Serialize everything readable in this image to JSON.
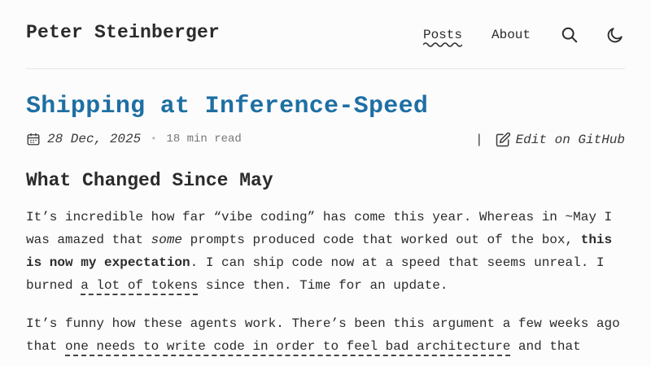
{
  "site": {
    "title": "Peter Steinberger"
  },
  "nav": {
    "posts_label": "Posts",
    "about_label": "About",
    "search_icon": "search-icon",
    "theme_icon": "moon-icon"
  },
  "post": {
    "title": "Shipping at Inference-Speed",
    "date": "28 Dec, 2025",
    "separator_dot": "•",
    "read_time": "18 min read",
    "meta_separator": "|",
    "edit_label": "Edit on GitHub",
    "section_heading": "What Changed Since May",
    "p1": {
      "t1": "It’s incredible how far “vibe coding” has come this year. Whereas in ~May I was amazed that ",
      "em1": "some",
      "t2": " prompts produced code that worked out of the box, ",
      "b1": "this is now my expectation",
      "t3": ". I can ship code now at a speed that seems unreal. I burned ",
      "link1": "a lot of tokens",
      "t4": " since then. Time for an update."
    },
    "p2": {
      "t1": "It’s funny how these agents work. There’s been this argument a few weeks ago that ",
      "link1": "one needs to write code in order to feel bad architecture",
      "t2": " and that"
    }
  },
  "colors": {
    "title": "#1e6fa3",
    "text": "#2b2b2b",
    "muted": "#777777",
    "background": "#fdfcfd"
  }
}
